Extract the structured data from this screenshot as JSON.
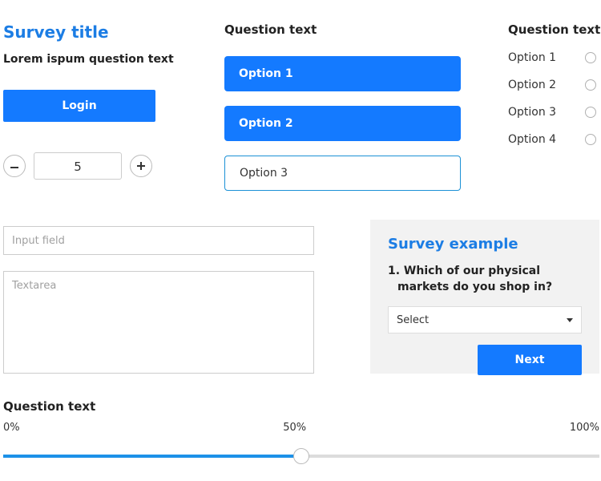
{
  "col1": {
    "title": "Survey title",
    "lorem": "Lorem ispum question text",
    "login": "Login",
    "stepper_value": "5"
  },
  "col2": {
    "heading": "Question text",
    "options": [
      "Option 1",
      "Option 2",
      "Option 3"
    ]
  },
  "col3": {
    "heading": "Question text",
    "options": [
      "Option 1",
      "Option 2",
      "Option 3",
      "Option 4"
    ]
  },
  "input_placeholder": "Input field",
  "textarea_placeholder": "Textarea",
  "card": {
    "title": "Survey example",
    "q": "1. Which of our physical markets do you shop in?",
    "select_label": "Select",
    "next": "Next"
  },
  "slider": {
    "heading": "Question text",
    "min_label": "0%",
    "mid_label": "50%",
    "max_label": "100%"
  }
}
